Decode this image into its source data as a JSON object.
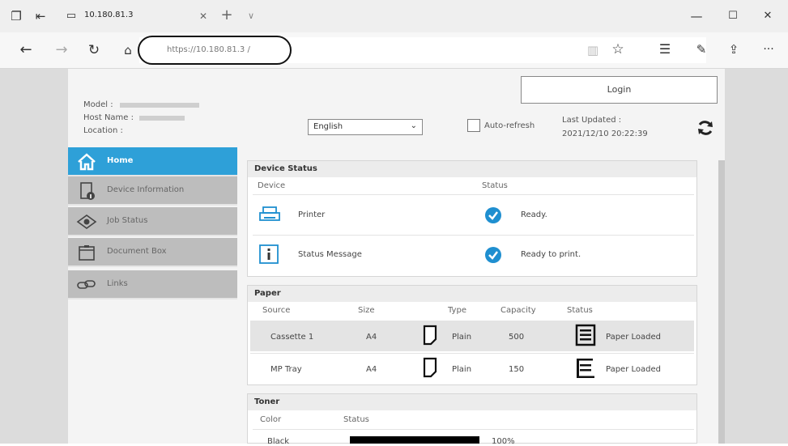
{
  "browser": {
    "tab_title": "10.180.81.3",
    "new_tab_label": "+",
    "tab_menu_label": "∨",
    "url": "https://10.180.81.3 /",
    "window_controls": {
      "minimize": "—",
      "maximize": "☐",
      "close": "✕"
    },
    "more_label": "···"
  },
  "header": {
    "model_label": "Model :",
    "host_label": "Host Name :",
    "location_label": "Location :",
    "language": "English",
    "auto_refresh_label": "Auto-refresh",
    "last_updated_label": "Last Updated :",
    "last_updated_value": "2021/12/10 20:22:39",
    "login_label": "Login"
  },
  "nav": {
    "items": [
      {
        "label": "Home",
        "icon": "home-icon",
        "active": true
      },
      {
        "label": "Device Information",
        "icon": "device-info-icon",
        "active": false
      },
      {
        "label": "Job Status",
        "icon": "eye-icon",
        "active": false
      },
      {
        "label": "Document Box",
        "icon": "folder-icon",
        "active": false
      },
      {
        "label": "Links",
        "icon": "link-icon",
        "active": false
      }
    ]
  },
  "device_status": {
    "title": "Device Status",
    "col_device": "Device",
    "col_status": "Status",
    "rows": [
      {
        "device": "Printer",
        "status": "Ready."
      },
      {
        "device": "Status Message",
        "status": "Ready to print."
      }
    ]
  },
  "paper": {
    "title": "Paper",
    "columns": [
      "Source",
      "Size",
      "Type",
      "Capacity",
      "Status"
    ],
    "rows": [
      {
        "source": "Cassette 1",
        "size": "A4",
        "type": "Plain",
        "capacity": "500",
        "status": "Paper Loaded"
      },
      {
        "source": "MP Tray",
        "size": "A4",
        "type": "Plain",
        "capacity": "150",
        "status": "Paper Loaded"
      }
    ]
  },
  "toner": {
    "title": "Toner",
    "col_color": "Color",
    "col_status": "Status",
    "rows": [
      {
        "color": "Black",
        "level": 1.0,
        "level_text": "100%"
      }
    ]
  },
  "colors": {
    "nav_active": "#2ea0d8",
    "check_blue": "#1f8fd0",
    "nav_inactive": "#bdbdbd"
  }
}
